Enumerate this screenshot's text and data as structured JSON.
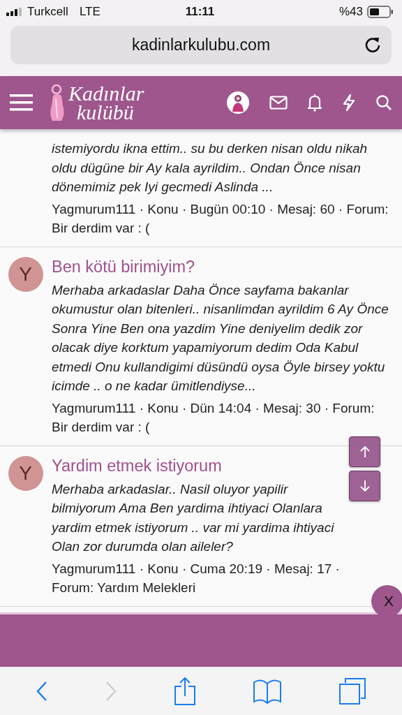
{
  "status_bar": {
    "carrier": "Turkcell",
    "network": "LTE",
    "time": "11:11",
    "battery": "%43"
  },
  "browser": {
    "url": "kadinlarkulubu.com"
  },
  "site_header": {
    "logo_line_1": "Kadınlar",
    "logo_line_2": "kulübü"
  },
  "posts": [
    {
      "excerpt": "istemiyordu ikna ettim.. su bu derken nisan oldu nikah oldu dügüne bir Ay kala ayrildim.. Ondan Önce nisan dönemimiz pek Iyi gecmedi Aslinda ...",
      "meta": "Yagmurum111 · Konu · Bugün 00:10 · Mesaj: 60 · Forum: Bir derdim var : ("
    },
    {
      "avatar": "Y",
      "title": "Ben kötü birimiyim?",
      "excerpt": "Merhaba arkadaslar Daha Önce sayfama bakanlar okumustur olan bitenleri.. nisanlimdan ayrildim 6 Ay Önce Sonra Yine Ben ona yazdim Yine deniyelim dedik zor olacak diye korktum yapamiyorum dedim Oda Kabul etmedi Onu kullandigimi düsündü oysa Öyle birsey yoktu icimde .. o ne kadar ümitlendiyse...",
      "meta": "Yagmurum111 · Konu · Dün 14:04 · Mesaj: 30 · Forum: Bir derdim var : ("
    },
    {
      "avatar": "Y",
      "title": "Yardim etmek istiyorum",
      "excerpt": "Merhaba arkadaslar.. Nasil oluyor yapilir bilmiyorum Ama Ben yardima ihtiyaci Olanlara yardim etmek istiyorum .. var mi yardima ihtiyaci Olan zor durumda olan aileler?",
      "meta": "Yagmurum111 · Konu · Cuma 20:19 · Mesaj: 17 · Forum: Yardım Melekleri"
    }
  ],
  "close_button": "X",
  "toolbar": [
    {
      "kind": "back",
      "disabled": false
    },
    {
      "kind": "forward",
      "disabled": true
    },
    {
      "kind": "share",
      "disabled": false
    },
    {
      "kind": "bookmarks",
      "disabled": false
    },
    {
      "kind": "tabs",
      "disabled": false
    }
  ]
}
